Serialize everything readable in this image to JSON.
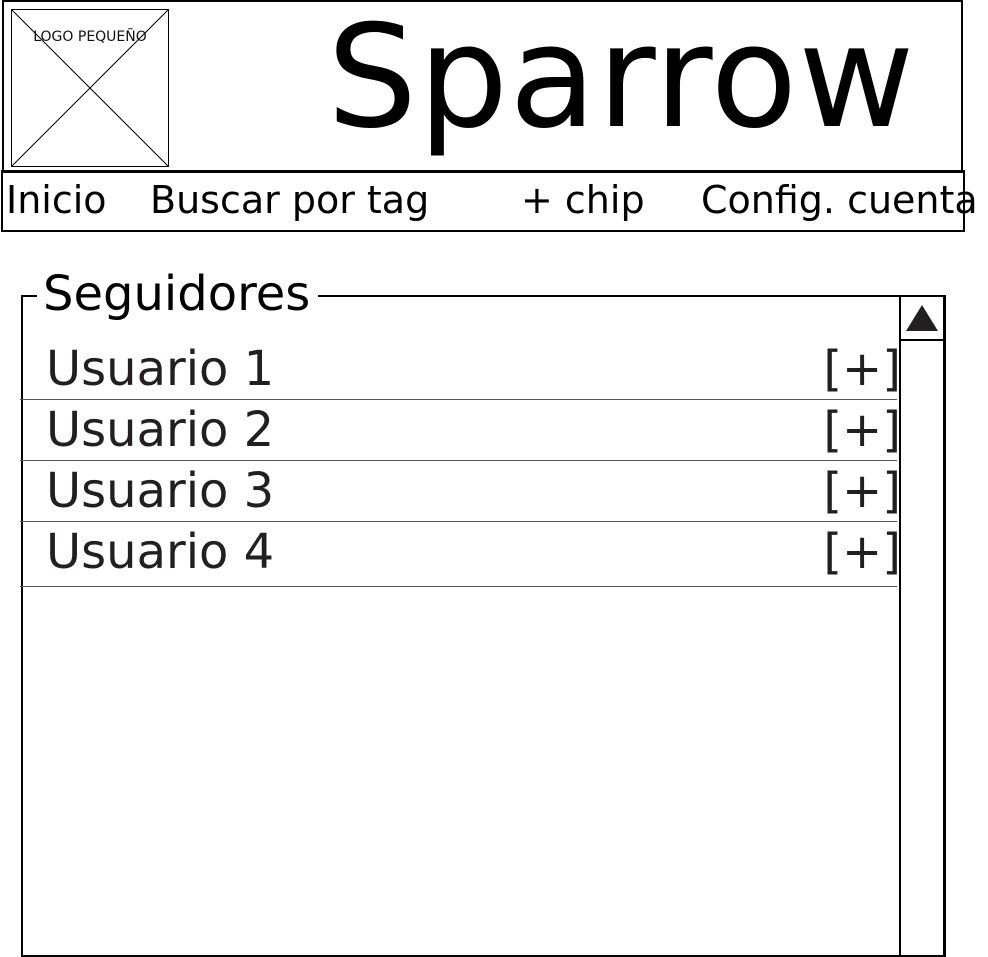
{
  "header": {
    "logo_text": "LOGO PEQUEÑO",
    "title": "Sparrow"
  },
  "nav": {
    "items": [
      {
        "label": "Inicio"
      },
      {
        "label": "Buscar por tag"
      },
      {
        "label": "+ chip"
      },
      {
        "label": "Config. cuenta"
      }
    ]
  },
  "followers": {
    "title": "Seguidores",
    "users": [
      {
        "name": "Usuario 1",
        "action": "[+]"
      },
      {
        "name": "Usuario 2",
        "action": "[+]"
      },
      {
        "name": "Usuario 3",
        "action": "[+]"
      },
      {
        "name": "Usuario 4",
        "action": "[+]"
      }
    ]
  },
  "icons": {
    "logo": "image-placeholder-icon",
    "scroll_up": "triangle-up-icon"
  },
  "colors": {
    "text": "#000000",
    "list_text": "#231f20",
    "background": "#ffffff"
  }
}
